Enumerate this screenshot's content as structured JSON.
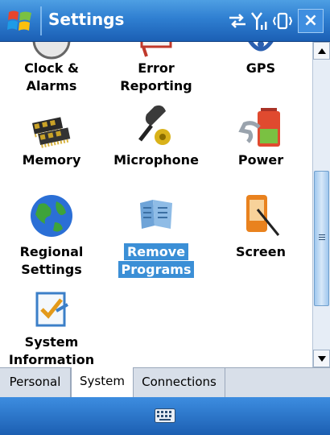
{
  "window": {
    "title": "Settings"
  },
  "titlebar": {
    "status_icons": [
      "connectivity-icon",
      "signal-icon",
      "vibrate-icon"
    ],
    "close_label": "×"
  },
  "tiles": [
    {
      "line1": "Clock &",
      "line2": "Alarms",
      "icon": "clock-icon",
      "selected": false
    },
    {
      "line1": "Error",
      "line2": "Reporting",
      "icon": "error-reporting-icon",
      "selected": false
    },
    {
      "line1": "GPS",
      "line2": "",
      "icon": "gps-icon",
      "selected": false
    },
    {
      "line1": "Memory",
      "line2": "",
      "icon": "memory-chip-icon",
      "selected": false
    },
    {
      "line1": "Microphone",
      "line2": "",
      "icon": "microphone-icon",
      "selected": false
    },
    {
      "line1": "Power",
      "line2": "",
      "icon": "battery-icon",
      "selected": false
    },
    {
      "line1": "Regional",
      "line2": "Settings",
      "icon": "globe-icon",
      "selected": false
    },
    {
      "line1": "Remove",
      "line2": "Programs",
      "icon": "remove-programs-icon",
      "selected": true
    },
    {
      "line1": "Screen",
      "line2": "",
      "icon": "screen-stylus-icon",
      "selected": false
    },
    {
      "line1": "System",
      "line2": "Information",
      "icon": "system-info-icon",
      "selected": false
    }
  ],
  "tabs": [
    {
      "label": "Personal",
      "active": false
    },
    {
      "label": "System",
      "active": true
    },
    {
      "label": "Connections",
      "active": false
    }
  ],
  "bottombar": {
    "icon": "keyboard-icon"
  },
  "colors": {
    "titlebar": "#2f7fd1",
    "selection": "#3b8fd6"
  }
}
